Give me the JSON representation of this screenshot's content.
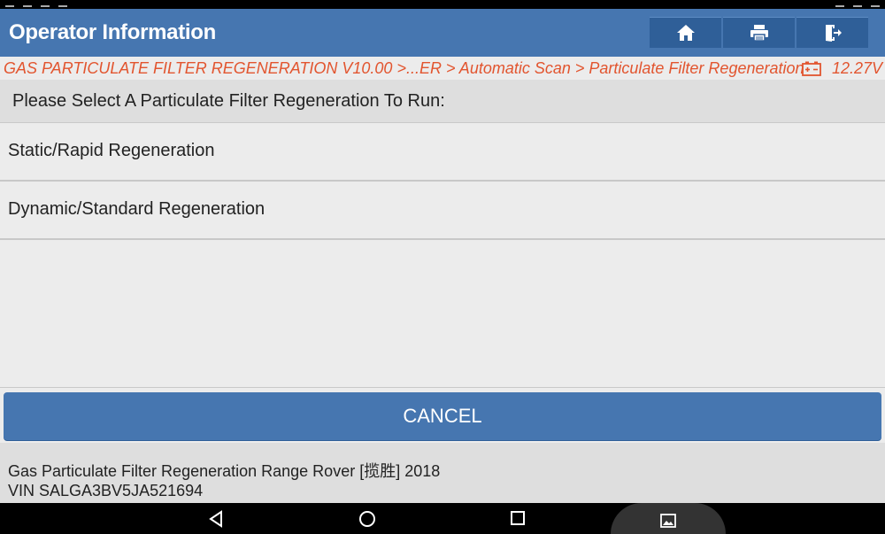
{
  "header": {
    "title": "Operator Information",
    "buttons": [
      {
        "icon": "home-icon"
      },
      {
        "icon": "printer-icon"
      },
      {
        "icon": "exit-icon"
      }
    ]
  },
  "breadcrumb": {
    "path": "GAS PARTICULATE FILTER REGENERATION V10.00 >...ER > Automatic Scan > Particulate Filter Regeneration",
    "battery_icon": "battery-icon",
    "voltage": "12.27V"
  },
  "prompt": "Please Select A Particulate Filter Regeneration To Run:",
  "options": [
    {
      "label": "Static/Rapid Regeneration"
    },
    {
      "label": "Dynamic/Standard Regeneration"
    }
  ],
  "cancel_label": "CANCEL",
  "footer": {
    "line1": "Gas Particulate Filter Regeneration Range Rover [揽胜] 2018",
    "line2": "VIN SALGA3BV5JA521694"
  },
  "navbar": {
    "icons": [
      "back-icon",
      "home-circle-icon",
      "recents-icon",
      "gallery-icon"
    ]
  },
  "colors": {
    "header_bg": "#4676b0",
    "header_button_bg": "#2f5f98",
    "breadcrumb_text": "#e2552f",
    "cancel_bg": "#4676b0"
  }
}
